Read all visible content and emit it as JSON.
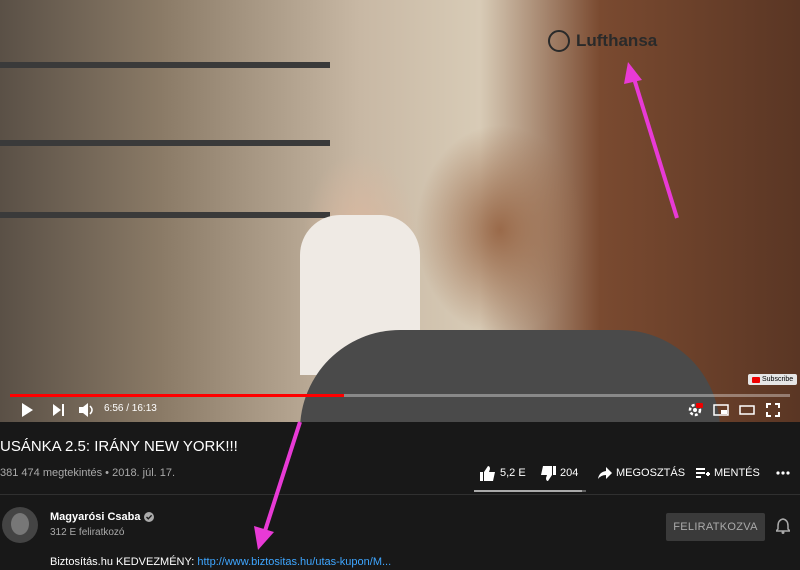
{
  "video": {
    "brand_sign": "Lufthansa",
    "subscribe_badge": "Subscribe",
    "time": "6:56 / 16:13",
    "progress": 0.428,
    "accent_color": "#ff0000",
    "annotation_color": "#e83ad6"
  },
  "title": "USÁNKA 2.5: IRÁNY NEW YORK!!!",
  "stats": "381 474 megtekintés • 2018. júl. 17.",
  "actions": {
    "likes": "5,2 E",
    "dislikes": "204",
    "share": "MEGOSZTÁS",
    "save": "MENTÉS",
    "like_ratio": 0.96
  },
  "channel": {
    "name": "Magyarósi Csaba",
    "subscribers": "312 E feliratkozó",
    "subscribe_button": "FELIRATKOZVA"
  },
  "description": {
    "prefix": "Biztosítás.hu KEDVEZMÉNY: ",
    "link": "http://www.biztositas.hu/utas-kupon/M..."
  },
  "icons": [
    "play-icon",
    "next-icon",
    "volume-icon",
    "settings-icon",
    "miniplayer-icon",
    "theater-icon",
    "fullscreen-icon",
    "like-icon",
    "dislike-icon",
    "share-icon",
    "save-icon",
    "more-icon",
    "verified-icon",
    "bell-icon"
  ]
}
